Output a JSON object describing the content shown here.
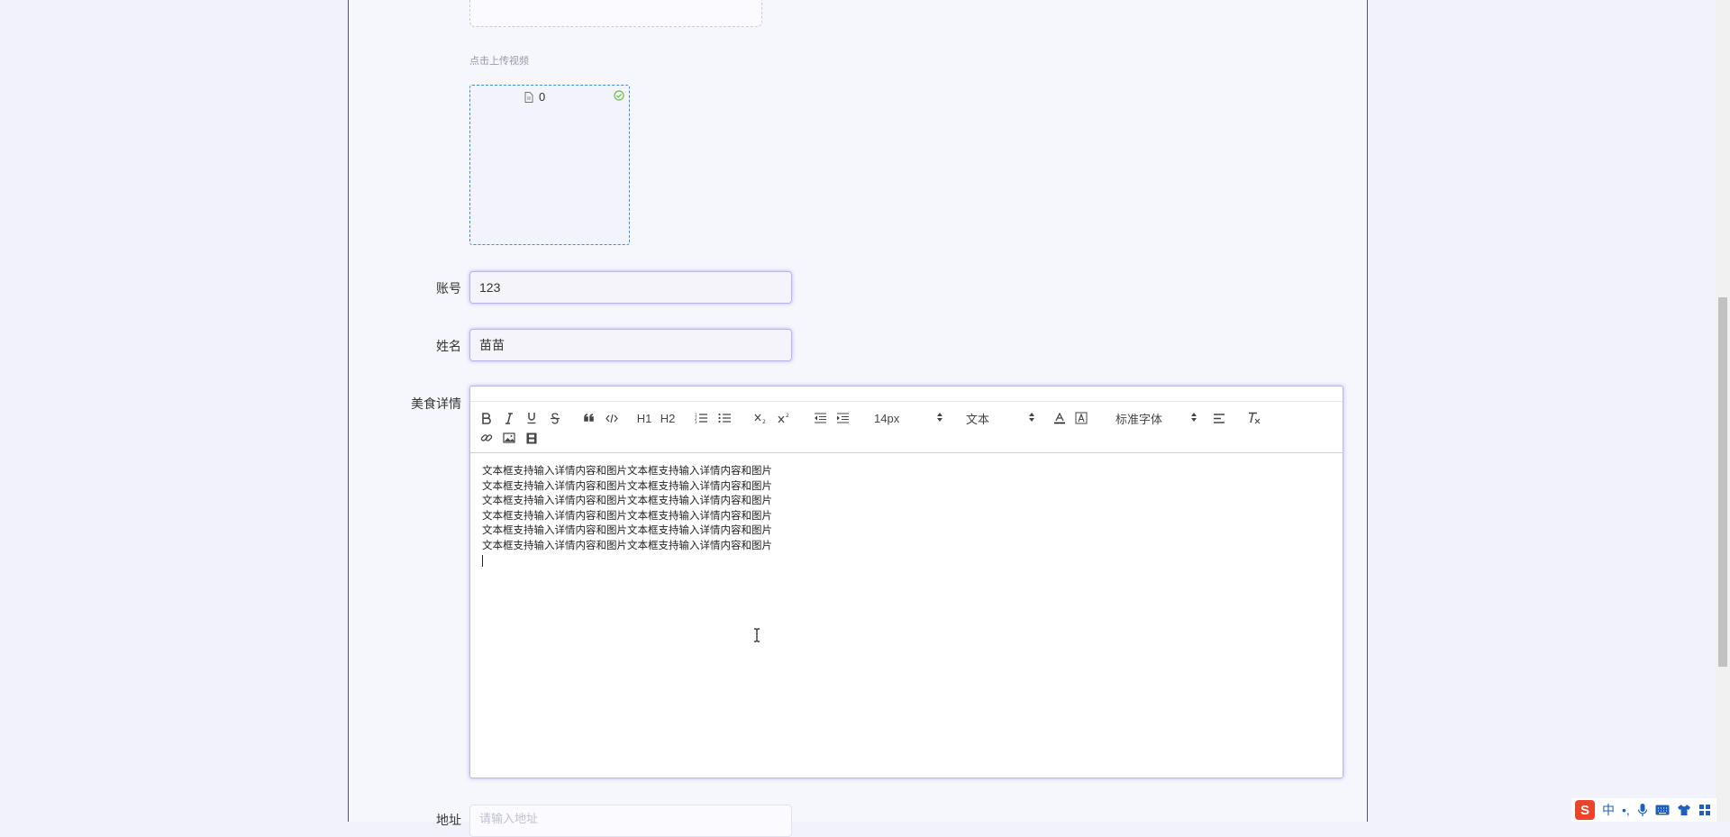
{
  "upload": {
    "hint": "点击上传视频",
    "file_name": "0"
  },
  "fields": {
    "account_label": "账号",
    "account_value": "123",
    "name_label": "姓名",
    "name_value": "苗苗",
    "detail_label": "美食详情",
    "address_label": "地址",
    "address_placeholder": "请输入地址"
  },
  "toolbar": {
    "h1": "H1",
    "h2": "H2",
    "size_value": "14px",
    "header_value": "文本",
    "font_value": "标准字体"
  },
  "editor": {
    "lines": [
      "文本框支持输入详情内容和图片文本框支持输入详情内容和图片",
      "文本框支持输入详情内容和图片文本框支持输入详情内容和图片",
      "文本框支持输入详情内容和图片文本框支持输入详情内容和图片",
      "文本框支持输入详情内容和图片文本框支持输入详情内容和图片",
      "文本框支持输入详情内容和图片文本框支持输入详情内容和图片",
      "文本框支持输入详情内容和图片文本框支持输入详情内容和图片"
    ]
  },
  "ime": {
    "lang": "中",
    "punct": "•,"
  },
  "icons": [
    "bold-icon",
    "italic-icon",
    "underline-icon",
    "strike-icon",
    "blockquote-icon",
    "code-block-icon",
    "ordered-list-icon",
    "bullet-list-icon",
    "subscript-icon",
    "superscript-icon",
    "outdent-icon",
    "indent-icon",
    "text-color-icon",
    "background-color-icon",
    "align-icon",
    "clear-format-icon",
    "link-icon",
    "image-icon",
    "video-icon",
    "file-icon",
    "success-check-icon",
    "sogou-ime-icon",
    "microphone-icon",
    "keyboard-icon",
    "skin-icon",
    "apps-grid-icon",
    "text-cursor-icon"
  ],
  "colors": {
    "page_bg": "#f1f2fb",
    "panel_border": "#4b4f8a",
    "input_glow": "#b9b4e8",
    "upload_border": "#3d8ed6",
    "check_green": "#67c23a",
    "ime_red": "#e8452c"
  }
}
